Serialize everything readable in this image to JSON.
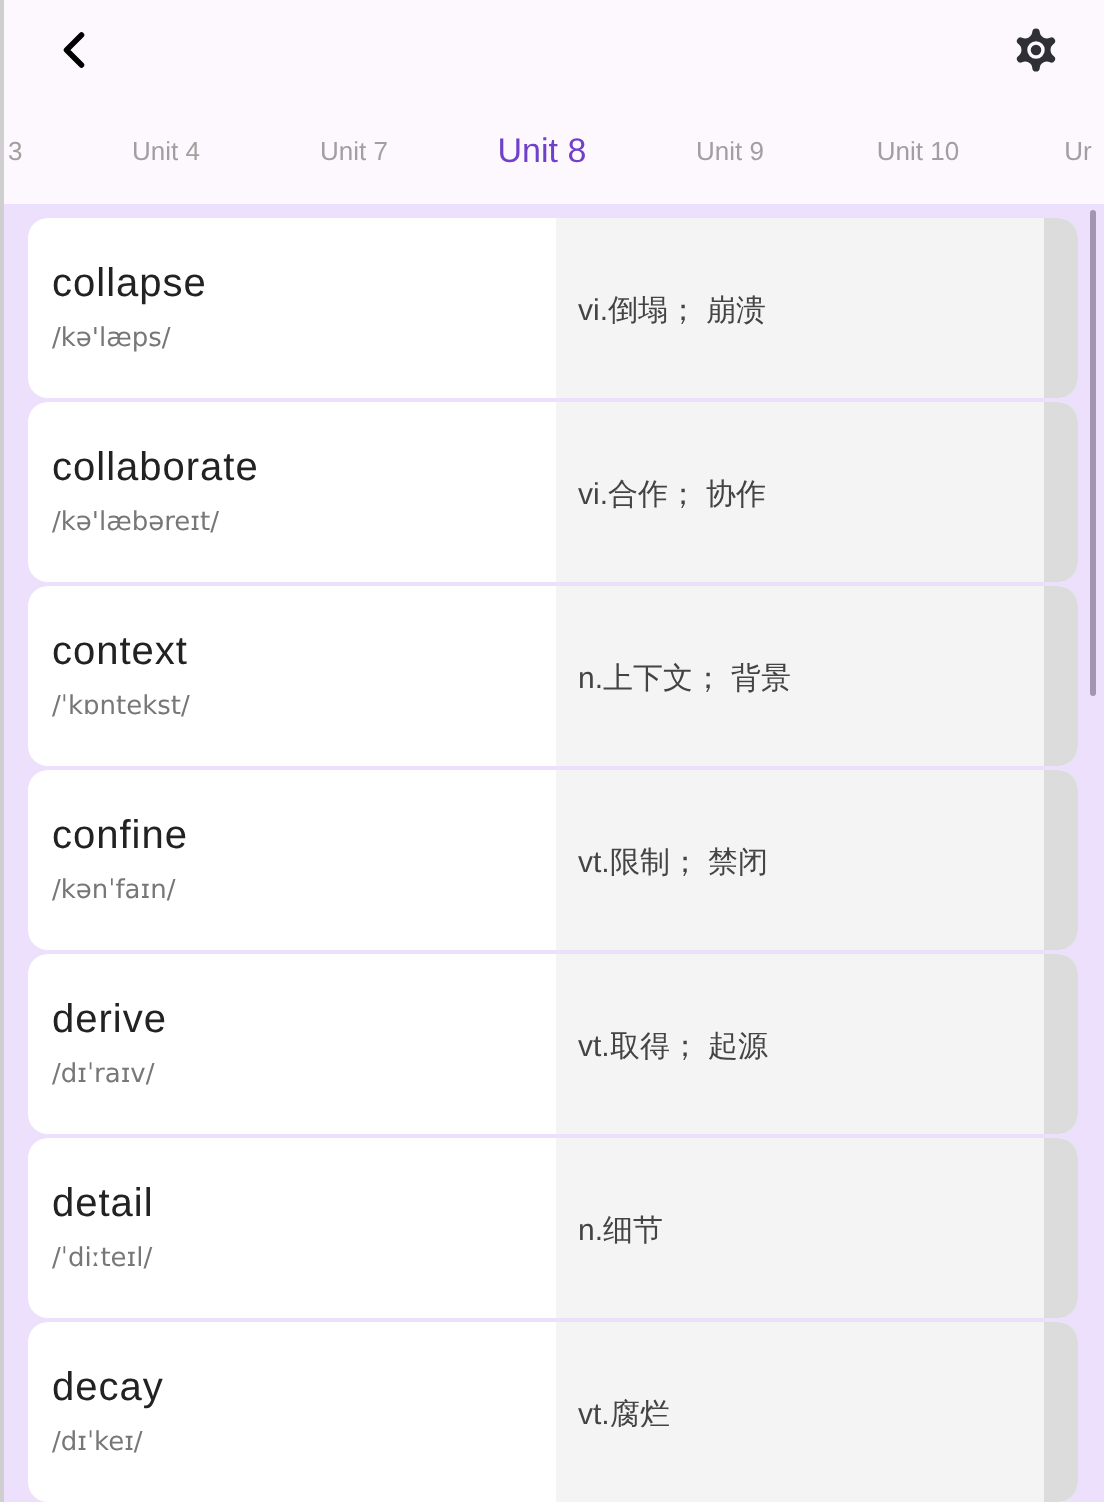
{
  "tabs": [
    {
      "label": "3",
      "selected": false
    },
    {
      "label": "Unit 4",
      "selected": false
    },
    {
      "label": "Unit 7",
      "selected": false
    },
    {
      "label": "Unit 8",
      "selected": true
    },
    {
      "label": "Unit 9",
      "selected": false
    },
    {
      "label": "Unit 10",
      "selected": false
    },
    {
      "label": "Ur",
      "selected": false
    }
  ],
  "words": [
    {
      "word": "collapse",
      "phonetic": "/kə'læps/",
      "meaning": "vi.倒塌； 崩溃"
    },
    {
      "word": "collaborate",
      "phonetic": "/kə'læbəreɪt/",
      "meaning": "vi.合作； 协作"
    },
    {
      "word": "context",
      "phonetic": "/ˈkɒntekst/",
      "meaning": "n.上下文； 背景"
    },
    {
      "word": "confine",
      "phonetic": "/kənˈfaɪn/",
      "meaning": "vt.限制； 禁闭"
    },
    {
      "word": "derive",
      "phonetic": "/dɪˈraɪv/",
      "meaning": "vt.取得； 起源"
    },
    {
      "word": "detail",
      "phonetic": "/ˈdiːteɪl/",
      "meaning": "n.细节"
    },
    {
      "word": "decay",
      "phonetic": "/dɪˈkeɪ/",
      "meaning": "vt.腐烂"
    }
  ]
}
